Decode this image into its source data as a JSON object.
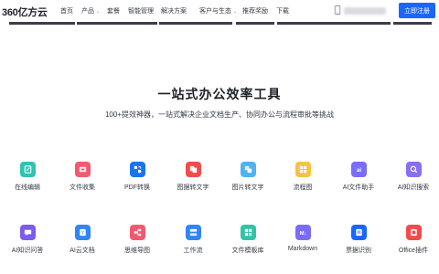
{
  "nav": {
    "logo": "360亿方云",
    "items": [
      {
        "label": "首页",
        "has_dropdown": false
      },
      {
        "label": "产品",
        "has_dropdown": true
      },
      {
        "label": "套餐",
        "has_dropdown": false
      },
      {
        "label": "智能管理",
        "has_dropdown": false
      },
      {
        "label": "解决方案",
        "has_dropdown": false
      },
      {
        "label": "客户与生态",
        "has_dropdown": true
      },
      {
        "label": "推荐奖励",
        "has_dropdown": false
      },
      {
        "label": "下载",
        "has_dropdown": false
      }
    ],
    "dropdown_caret": "⌄",
    "phone_icon": "phone-icon",
    "register_label": "立即注册",
    "accent_color": "#1a66ff"
  },
  "hero": {
    "title": "一站式办公效率工具",
    "subtitle": "100+提效神器，一站式解决企业文档生产、协同办公与流程审批等挑战"
  },
  "tools": [
    {
      "label": "在线编辑",
      "icon": "edit-icon",
      "color": "#2fc4b2"
    },
    {
      "label": "文件收集",
      "icon": "collect-icon",
      "color": "#f05a6e"
    },
    {
      "label": "PDF转换",
      "icon": "pdf-convert-icon",
      "color": "#1a73f5"
    },
    {
      "label": "图据转文字",
      "icon": "ocr-icon",
      "color": "#f24b4b"
    },
    {
      "label": "图片转文字",
      "icon": "image-text-icon",
      "color": "#4fb3f2"
    },
    {
      "label": "流程图",
      "icon": "flowchart-icon",
      "color": "#f5c242"
    },
    {
      "label": "AI文件助手",
      "icon": "ai-file-icon",
      "color": "#7b6cf6"
    },
    {
      "label": "AI知识搜索",
      "icon": "ai-search-icon",
      "color": "#8a6df2"
    },
    {
      "label": "AI知识问答",
      "icon": "ai-qa-icon",
      "color": "#7a5cf0"
    },
    {
      "label": "AI云文档",
      "icon": "ai-doc-icon",
      "color": "#2f86f6"
    },
    {
      "label": "思维导图",
      "icon": "mindmap-icon",
      "color": "#f05a6e"
    },
    {
      "label": "工作流",
      "icon": "workflow-icon",
      "color": "#2f86f6"
    },
    {
      "label": "文件模板库",
      "icon": "template-icon",
      "color": "#2fc4a8"
    },
    {
      "label": "Markdown",
      "icon": "markdown-icon",
      "color": "#7b6cf6"
    },
    {
      "label": "票据识别",
      "icon": "invoice-icon",
      "color": "#1a66ff"
    },
    {
      "label": "Office插件",
      "icon": "office-icon",
      "color": "#f24b4b"
    }
  ]
}
